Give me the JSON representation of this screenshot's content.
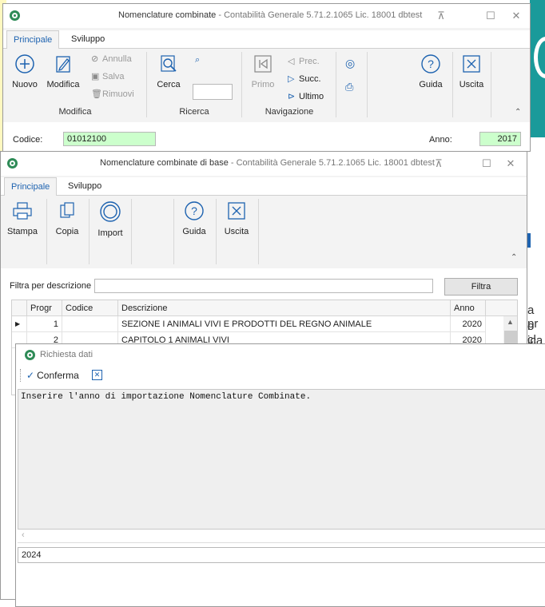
{
  "w1": {
    "title": "Nomenclature combinate",
    "subtitle": " - Contabilità Generale 5.71.2.1065 Lic. 18001 dbtest",
    "tabs": [
      "Principale",
      "Sviluppo"
    ],
    "ribbon": {
      "nuovo": "Nuovo",
      "modifica": "Modifica",
      "annulla": "Annulla",
      "salva": "Salva",
      "rimuovi": "Rimuovi",
      "cerca": "Cerca",
      "primo": "Primo",
      "prec": "Prec.",
      "succ": "Succ.",
      "ultimo": "Ultimo",
      "guida": "Guida",
      "uscita": "Uscita"
    },
    "groups": {
      "modifica": "Modifica",
      "ricerca": "Ricerca",
      "navigazione": "Navigazione"
    },
    "codice_label": "Codice:",
    "codice_value": "01012100",
    "anno_label": "Anno:",
    "anno_value": "2017"
  },
  "w2": {
    "title": "Nomenclature combinate di base",
    "subtitle": " - Contabilità Generale 5.71.2.1065 Lic. 18001 dbtest",
    "tabs": [
      "Principale",
      "Sviluppo"
    ],
    "ribbon": {
      "stampa": "Stampa",
      "copia": "Copia",
      "import": "Import",
      "guida": "Guida",
      "uscita": "Uscita"
    },
    "filter_label": "Filtra per descrizione",
    "filter_value": "",
    "filter_button": "Filtra",
    "columns": [
      "Progr",
      "Codice",
      "Descrizione",
      "Anno"
    ],
    "rows": [
      {
        "progr": "1",
        "codice": "",
        "descrizione": "SEZIONE I ANIMALI VIVI E PRODOTTI DEL REGNO ANIMALE",
        "anno": "2020"
      },
      {
        "progr": "2",
        "codice": "",
        "descrizione": "CAPITOLO 1 ANIMALI VIVI",
        "anno": "2020"
      }
    ]
  },
  "w3": {
    "title": "Richiesta dati",
    "conferma": "Conferma",
    "message": "Inserire l'anno di importazione Nomenclature Combinate.",
    "input_value": "2024"
  },
  "background": {
    "text_lines": [
      "a pr",
      "o cl",
      "ica"
    ]
  },
  "colors": {
    "accent": "#1e63b0",
    "green_field": "#ccffcc",
    "teal": "#1a9a9a"
  }
}
